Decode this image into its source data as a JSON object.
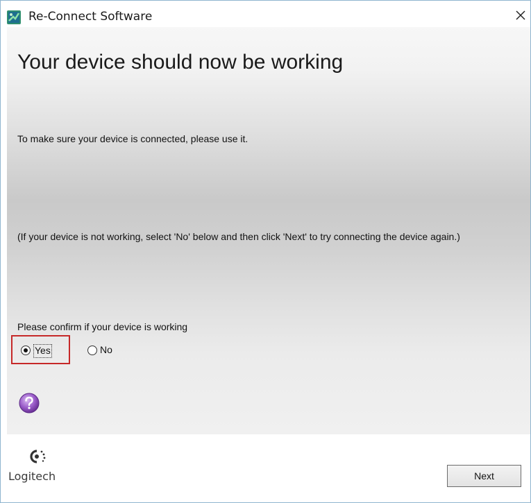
{
  "window": {
    "title": "Re-Connect Software",
    "close_symbol": "✕"
  },
  "main": {
    "heading": "Your device should now be working",
    "info_text": "To make sure your device is connected, please use it.",
    "note_text": "(If your device is not working, select 'No' below and then click 'Next' to try connecting the device again.)",
    "confirm_label": "Please confirm if your device is working",
    "options": [
      {
        "label": "Yes",
        "selected": true
      },
      {
        "label": "No",
        "selected": false
      }
    ],
    "help_icon": "question-mark-icon"
  },
  "footer": {
    "logo_text": "Logitech",
    "next_label": "Next"
  },
  "colors": {
    "highlight_border": "#c62828",
    "help_purple": "#9a5cc9",
    "window_border": "#8fb4cf"
  }
}
